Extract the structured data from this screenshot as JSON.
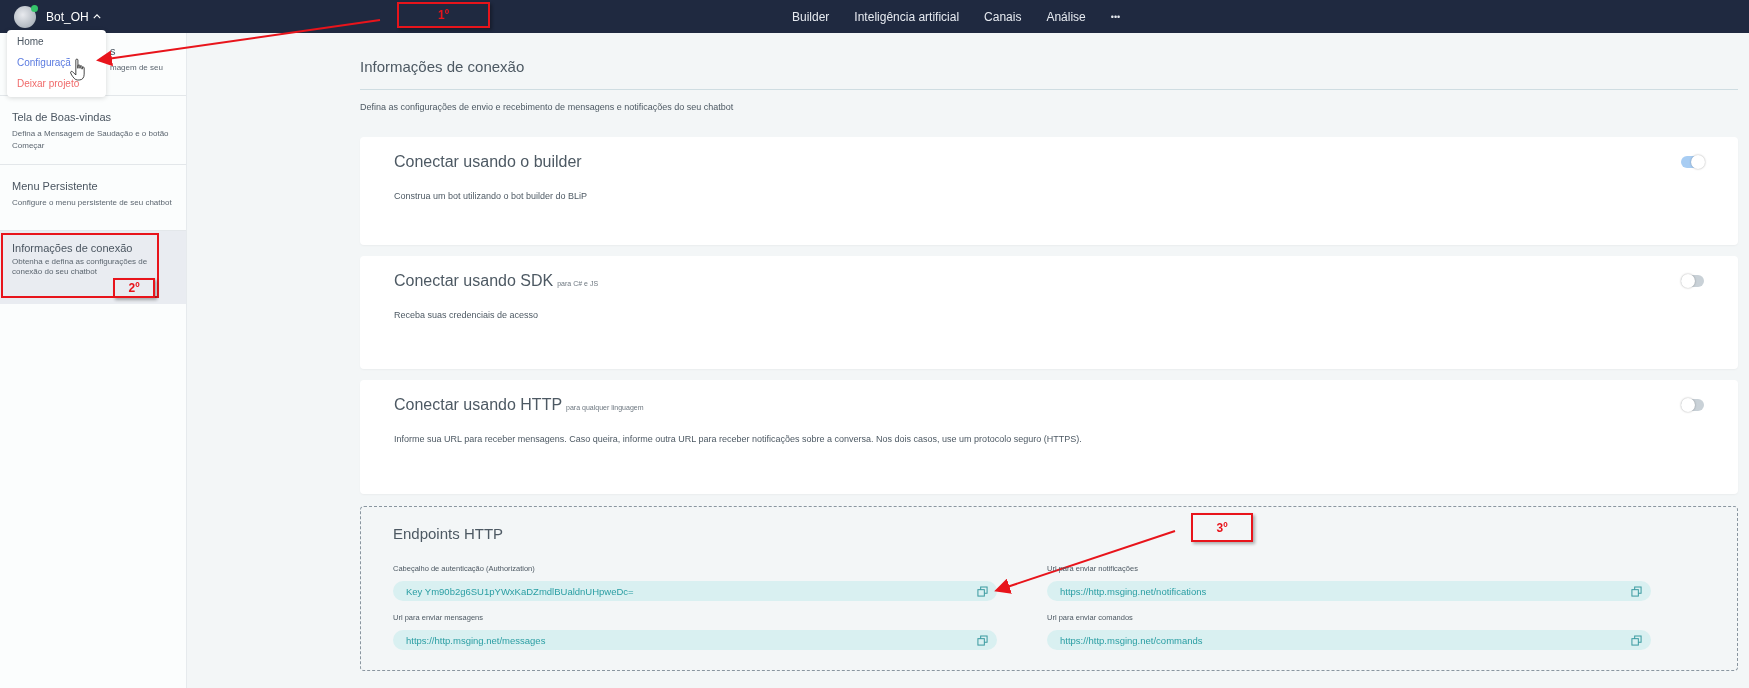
{
  "top_bar": {
    "project": {
      "name": "Bot_OH",
      "online": true,
      "expanded": true
    },
    "nav": [
      {
        "label": "Builder"
      },
      {
        "label": "Inteligência artificial"
      },
      {
        "label": "Canais"
      },
      {
        "label": "Análise"
      }
    ],
    "more": "•••"
  },
  "project_menu": [
    {
      "label": "Home",
      "kind": "normal"
    },
    {
      "label": "Configuraçã",
      "kind": "hover"
    },
    {
      "label": "Deixar projeto",
      "kind": "danger"
    }
  ],
  "sidebar": {
    "items": [
      {
        "title": "s",
        "description": "magem de seu",
        "selected": false
      },
      {
        "title": "Tela de Boas-vindas",
        "description": "Defina a Mensagem de Saudação e o botão Começar",
        "selected": false
      },
      {
        "title": "Menu Persistente",
        "description": "Configure o menu persistente de seu chatbot",
        "selected": false
      },
      {
        "title": "Informações de conexão",
        "description": "Obtenha e defina as configurações de conexão do seu chatbot",
        "selected": true
      }
    ]
  },
  "page": {
    "title": "Informações de conexão",
    "subtitle": "Defina as configurações de envio e recebimento de mensagens e notificações do seu chatbot"
  },
  "cards": [
    {
      "title": "Conectar usando o builder",
      "description": "Construa um bot utilizando o bot builder do BLiP",
      "on": true
    },
    {
      "title": "Conectar usando SDK",
      "note": "para C# e JS",
      "description": "Receba suas credenciais de acesso",
      "on": false
    },
    {
      "title": "Conectar usando HTTP",
      "note": "para qualquer linguagem",
      "description": "Informe sua URL para receber mensagens. Caso queira, informe outra URL para receber notificações sobre a conversa. Nos dois casos, use um protocolo seguro (HTTPS).",
      "on": false
    }
  ],
  "endpoints": {
    "title": "Endpoints HTTP",
    "fields": [
      {
        "label": "Cabeçalho de autenticação (Authorization)",
        "value": "Key Ym90b2g6SU1pYWxKaDZmdlBUaldnUHpweDc="
      },
      {
        "label": "Url para enviar notificações",
        "value": "https://http.msging.net/notifications"
      },
      {
        "label": "Url para enviar mensagens",
        "value": "https://http.msging.net/messages"
      },
      {
        "label": "Url para enviar comandos",
        "value": "https://http.msging.net/commands"
      }
    ]
  },
  "annotations": [
    {
      "label": "1º"
    },
    {
      "label": "2º"
    },
    {
      "label": "3º"
    }
  ]
}
